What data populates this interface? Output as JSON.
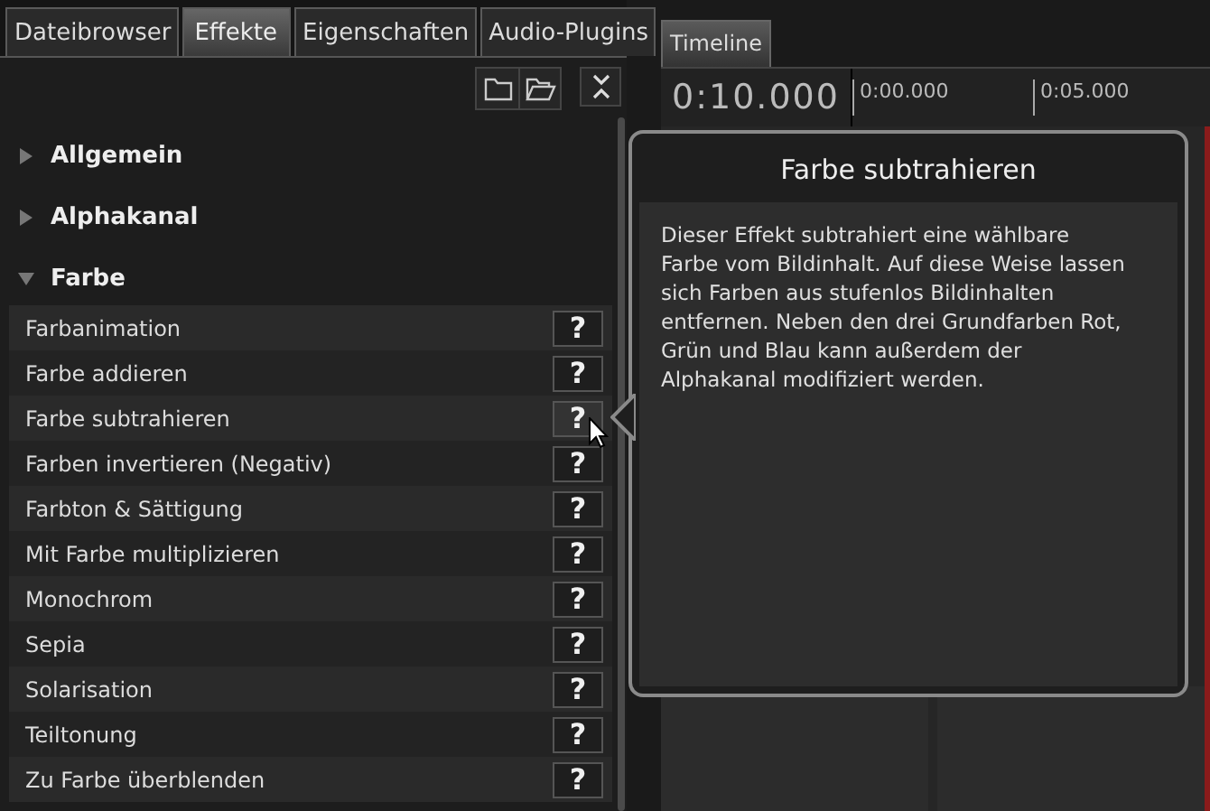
{
  "left_tabs": [
    {
      "label": "Dateibrowser",
      "selected": false
    },
    {
      "label": "Effekte",
      "selected": true
    },
    {
      "label": "Eigenschaften",
      "selected": false
    },
    {
      "label": "Audio-Plugins",
      "selected": false
    }
  ],
  "categories": [
    {
      "label": "Allgemein",
      "expanded": false
    },
    {
      "label": "Alphakanal",
      "expanded": false
    },
    {
      "label": "Farbe",
      "expanded": true,
      "children": [
        {
          "label": "Farbanimation",
          "help": "?",
          "hovered": false
        },
        {
          "label": "Farbe addieren",
          "help": "?",
          "hovered": false
        },
        {
          "label": "Farbe subtrahieren",
          "help": "?",
          "hovered": true
        },
        {
          "label": "Farben invertieren (Negativ)",
          "help": "?",
          "hovered": false
        },
        {
          "label": "Farbton & Sättigung",
          "help": "?",
          "hovered": false
        },
        {
          "label": "Mit Farbe multiplizieren",
          "help": "?",
          "hovered": false
        },
        {
          "label": "Monochrom",
          "help": "?",
          "hovered": false
        },
        {
          "label": "Sepia",
          "help": "?",
          "hovered": false
        },
        {
          "label": "Solarisation",
          "help": "?",
          "hovered": false
        },
        {
          "label": "Teiltonung",
          "help": "?",
          "hovered": false
        },
        {
          "label": "Zu Farbe überblenden",
          "help": "?",
          "hovered": false
        }
      ]
    }
  ],
  "timeline": {
    "tab": "Timeline",
    "time": "0:10.000",
    "ruler_labels": [
      "0:00.000",
      "0:05.000"
    ]
  },
  "tooltip": {
    "title": "Farbe subtrahieren",
    "body": "Dieser Effekt subtrahiert eine wählbare Farbe vom Bildinhalt. Auf diese Weise lassen sich Farben aus stufenlos Bildinhalten entfernen. Neben den drei Grundfarben Rot, Grün und Blau kann außerdem der Alphakanal modifiziert werden."
  }
}
